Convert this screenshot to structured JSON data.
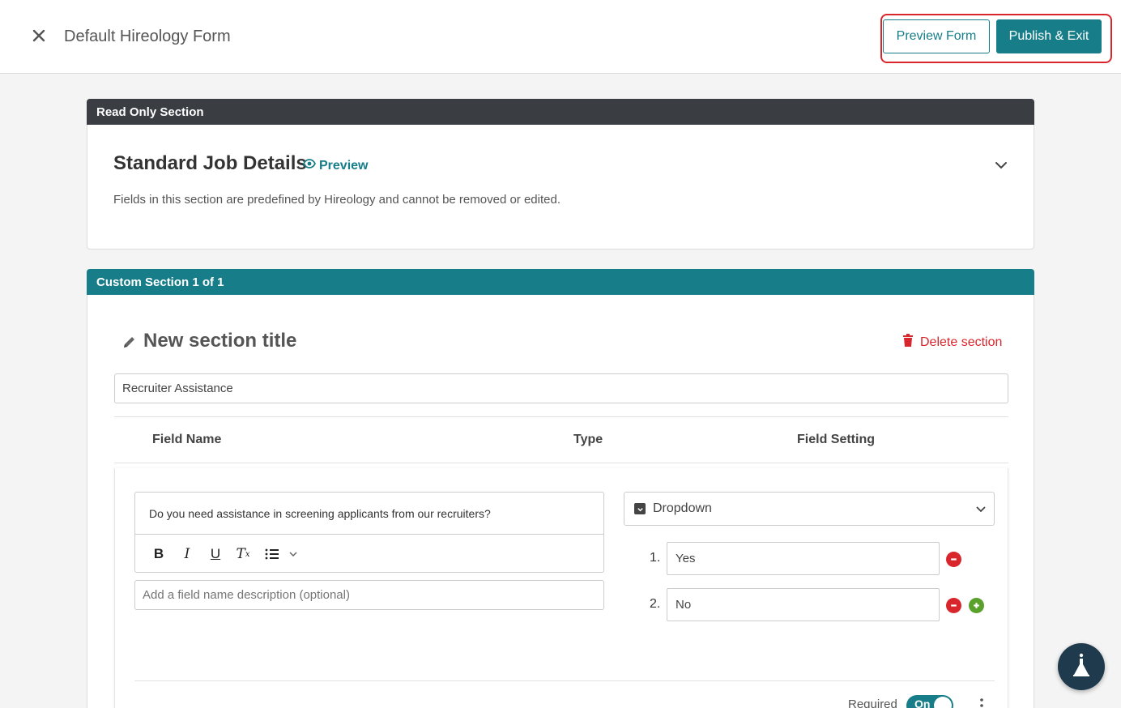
{
  "header": {
    "title": "Default Hireology Form",
    "preview_button": "Preview Form",
    "publish_button": "Publish & Exit"
  },
  "read_only_section": {
    "header_label": "Read Only Section",
    "title": "Standard Job Details",
    "preview_link": "Preview",
    "description": "Fields in this section are predefined by Hireology and cannot be removed or edited."
  },
  "custom_section": {
    "header_label": "Custom Section 1 of 1",
    "title": "New section title",
    "delete_label": "Delete section",
    "title_input_value": "Recruiter Assistance",
    "columns": [
      "Field Name",
      "Type",
      "Field Setting"
    ],
    "field": {
      "question": "Do you need assistance in screening applicants from our recruiters?",
      "description_placeholder": "Add a field name description (optional)",
      "type": "Dropdown",
      "options": [
        {
          "number": "1.",
          "value": "Yes"
        },
        {
          "number": "2.",
          "value": "No"
        }
      ],
      "required_label": "Required",
      "required_toggle": "On"
    }
  },
  "colors": {
    "accent": "#177e89",
    "dark_header": "#3a3d42",
    "danger": "#d9262c",
    "add_green": "#5aa02c"
  },
  "icons": [
    "close-icon",
    "eye-icon",
    "chevron-down-icon",
    "pencil-icon",
    "trash-icon",
    "bold-icon",
    "italic-icon",
    "underline-icon",
    "clear-format-icon",
    "list-icon",
    "checkbox-icon",
    "minus-circle-icon",
    "plus-circle-icon",
    "kebab-menu-icon",
    "flask-icon"
  ]
}
